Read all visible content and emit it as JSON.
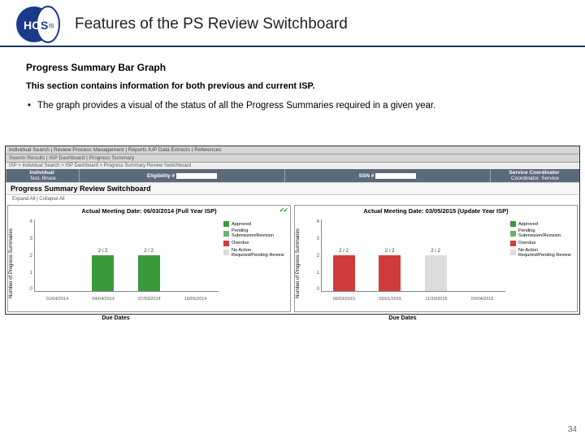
{
  "header": {
    "title": "Features of the PS Review Switchboard",
    "logo_text": "HCSis"
  },
  "section": {
    "title": "Progress Summary Bar Graph",
    "sub": "This section contains information for both previous and current ISP.",
    "bullet": "The graph provides a visual of the status of all the Progress Summaries required in a given year."
  },
  "nav": {
    "row1": "Individual Search  |  Review Process Management  |  Reports      IUP Data Extracts  |  References",
    "row2": "Search Results  |  ISP Dashboard  |  Progress Summary",
    "crumb": "ISP > Individual Search > ISP Dashboard > Progress Summary Review Switchboard"
  },
  "infobar": {
    "ind_lbl": "Individual",
    "ind_val": "Test, Bruce",
    "elig_lbl": "Eligibility #",
    "elig_val": "",
    "ssn_lbl": "SSN #",
    "ssn_val": "",
    "sc_lbl": "Service Coordinator",
    "sc_val": "Coordinator, Service"
  },
  "panel": {
    "title": "Progress Summary Review Switchboard",
    "expand": "Expand All | Collapse All"
  },
  "legend": {
    "approved": "Approved",
    "pending": "Pending Submission/Revision",
    "overdue": "Overdue",
    "noaction": "No Action Required/Pending Review"
  },
  "axes": {
    "ylabel": "Number of Progress Summaries",
    "xlabel": "Due Dates"
  },
  "chart_data": [
    {
      "type": "bar",
      "title": "Actual Meeting Date: 06/03/2014 (Full Year ISP)",
      "categories": [
        "01/04/2014",
        "04/04/2014",
        "07/03/2014",
        "10/05/2014"
      ],
      "ylim": [
        0,
        4
      ],
      "yticks": [
        0,
        1,
        2,
        3,
        4
      ],
      "series": [
        {
          "name": "Approved",
          "color": "#3a9a3a",
          "values": [
            0,
            2,
            2,
            0
          ]
        },
        {
          "name": "Pending Submission/Revision",
          "color": "#6db06d",
          "values": [
            0,
            0,
            0,
            0
          ]
        },
        {
          "name": "Overdue",
          "color": "#d23b3b",
          "values": [
            0,
            0,
            0,
            0
          ]
        },
        {
          "name": "No Action Required/Pending Review",
          "color": "#dcdcdc",
          "values": [
            0,
            0,
            0,
            0
          ]
        }
      ],
      "bar_labels": [
        "",
        "2 / 2",
        "2 / 2",
        ""
      ]
    },
    {
      "type": "bar",
      "title": "Actual Meeting Date: 03/05/2015 (Update Year ISP)",
      "categories": [
        "06/03/2015",
        "09/01/2015",
        "11/30/2015",
        "03/04/2016"
      ],
      "ylim": [
        0,
        4
      ],
      "yticks": [
        0,
        1,
        2,
        3,
        4
      ],
      "series": [
        {
          "name": "Approved",
          "color": "#3a9a3a",
          "values": [
            0,
            0,
            0,
            0
          ]
        },
        {
          "name": "Pending Submission/Revision",
          "color": "#6db06d",
          "values": [
            0,
            0,
            0,
            0
          ]
        },
        {
          "name": "Overdue",
          "color": "#d23b3b",
          "values": [
            2,
            2,
            0,
            0
          ]
        },
        {
          "name": "No Action Required/Pending Review",
          "color": "#dcdcdc",
          "values": [
            0,
            0,
            2,
            0
          ]
        }
      ],
      "bar_labels": [
        "2 / 2",
        "2 / 2",
        "2 / 2",
        ""
      ]
    }
  ],
  "page_number": "34"
}
